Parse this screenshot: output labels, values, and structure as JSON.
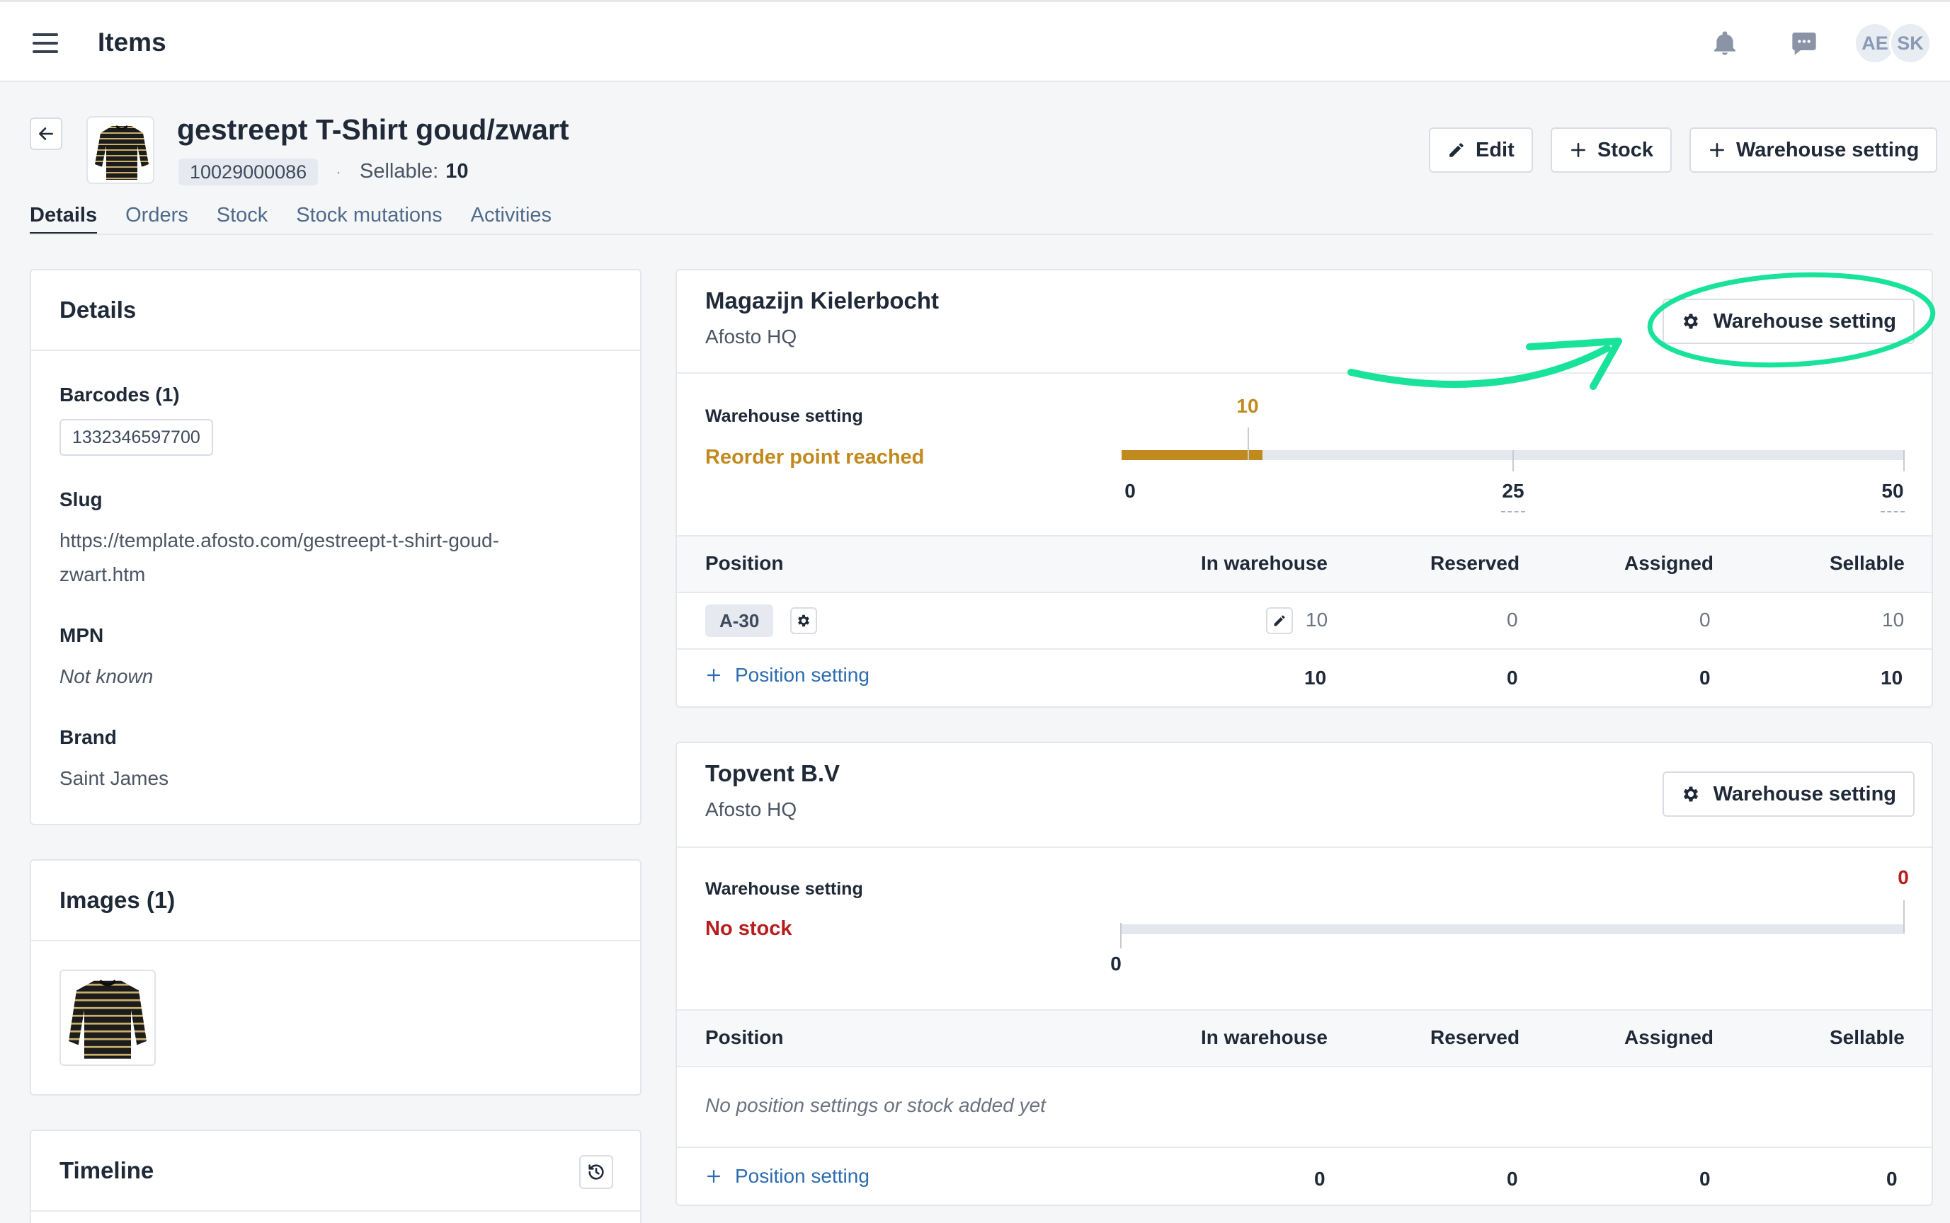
{
  "topbar": {
    "title": "Items",
    "icons": [
      "menu-icon",
      "bell-icon",
      "chat-icon"
    ],
    "avatars": [
      "AE",
      "SK"
    ]
  },
  "product": {
    "title": "gestreept T-Shirt goud/zwart",
    "sku": "10029000086",
    "separator": "·",
    "sellable_label": "Sellable:",
    "sellable_value": "10"
  },
  "header_buttons": {
    "edit": "Edit",
    "stock": "Stock",
    "warehouse_setting": "Warehouse setting"
  },
  "tabs": [
    "Details",
    "Orders",
    "Stock",
    "Stock mutations",
    "Activities"
  ],
  "details_card": {
    "title": "Details",
    "barcodes_label": "Barcodes (1)",
    "barcode": "1332346597700",
    "slug_label": "Slug",
    "slug_line1": "https://template.afosto.com/gestreept-t-shirt-goud-",
    "slug_line2": "zwart.htm",
    "mpn_label": "MPN",
    "mpn_value": "Not known",
    "brand_label": "Brand",
    "brand_value": "Saint James"
  },
  "images_card": {
    "title": "Images (1)"
  },
  "timeline_card": {
    "title": "Timeline"
  },
  "table_headers": {
    "position": "Position",
    "in_warehouse": "In warehouse",
    "reserved": "Reserved",
    "assigned": "Assigned",
    "sellable": "Sellable"
  },
  "warehouses": [
    {
      "name": "Magazijn Kielerbocht",
      "location": "Afosto HQ",
      "button": "Warehouse setting",
      "setting_label": "Warehouse setting",
      "status": "Reorder point reached",
      "status_color": "#c08a1e",
      "stock_value": 10,
      "stock_value_label": "10",
      "scale_max": 50,
      "ticks": [
        "0",
        "25",
        "50"
      ],
      "rows": [
        {
          "position": "A-30",
          "in_warehouse": "10",
          "reserved": "0",
          "assigned": "0",
          "sellable": "10"
        }
      ],
      "add_position": "Position setting",
      "totals": {
        "in_warehouse": "10",
        "reserved": "0",
        "assigned": "0",
        "sellable": "10"
      }
    },
    {
      "name": "Topvent B.V",
      "location": "Afosto HQ",
      "button": "Warehouse setting",
      "setting_label": "Warehouse setting",
      "status": "No stock",
      "status_color": "#b91c1c",
      "stock_value": 0,
      "stock_value_label": "0",
      "ticks": [
        "0"
      ],
      "empty_message": "No position settings or stock added yet",
      "add_position": "Position setting",
      "totals": {
        "in_warehouse": "0",
        "reserved": "0",
        "assigned": "0",
        "sellable": "0"
      }
    }
  ],
  "colors": {
    "accent_link": "#2c6cb0",
    "warning": "#c08a1e",
    "danger": "#b91c1c",
    "annotation": "#19e39a"
  }
}
